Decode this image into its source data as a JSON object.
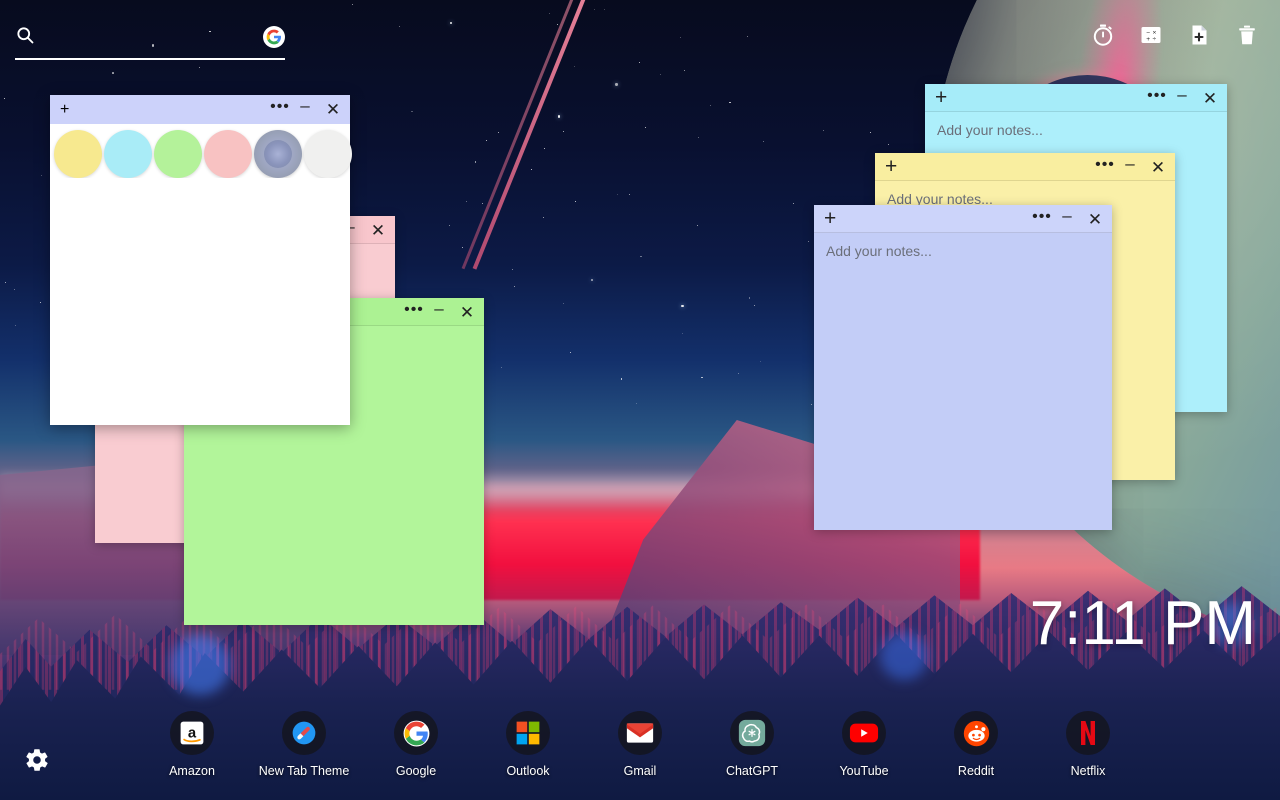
{
  "search": {
    "placeholder": "",
    "value": "",
    "icon": "search-icon",
    "brand_badge": "G"
  },
  "toolbar": {
    "items": [
      {
        "name": "timer-icon",
        "label": "Timer"
      },
      {
        "name": "calculator-icon",
        "label": "Calculator"
      },
      {
        "name": "new-note-icon",
        "label": "New Note"
      },
      {
        "name": "trash-icon",
        "label": "Trash"
      }
    ]
  },
  "color_picker": {
    "title_bar": {
      "add": "+",
      "menu": "•••",
      "minimize": "–",
      "close": "✕"
    },
    "title_bg": "#ccd2fa",
    "swatches": [
      {
        "name": "swatch-yellow",
        "color": "#f7e98f",
        "selected": false
      },
      {
        "name": "swatch-cyan",
        "color": "#a9ecf7",
        "selected": false
      },
      {
        "name": "swatch-green",
        "color": "#b4f29a",
        "selected": false
      },
      {
        "name": "swatch-pink",
        "color": "#f8c2c2",
        "selected": false
      },
      {
        "name": "swatch-purple",
        "color": "#7b86ad",
        "selected": true
      },
      {
        "name": "swatch-white",
        "color": "#f0f0ef",
        "selected": false
      }
    ]
  },
  "notes": [
    {
      "name": "note-cyan",
      "color": "#adeffb",
      "title_color": "#a6ecf9",
      "placeholder": "Add your notes...",
      "text": "",
      "buttons": {
        "add": "+",
        "menu": "•••",
        "minimize": "–",
        "close": "✕"
      }
    },
    {
      "name": "note-yellow",
      "color": "#faf0a8",
      "title_color": "#f9eea0",
      "placeholder": "Add your notes...",
      "text": "",
      "buttons": {
        "add": "+",
        "menu": "•••",
        "minimize": "–",
        "close": "✕"
      }
    },
    {
      "name": "note-periwinkle",
      "color": "#c3cdf7",
      "title_color": "#ccd4fa",
      "placeholder": "Add your notes...",
      "text": "",
      "buttons": {
        "add": "+",
        "menu": "•••",
        "minimize": "–",
        "close": "✕"
      }
    },
    {
      "name": "note-pink",
      "color": "#f9ccd1",
      "title_color": "#f8c6cc",
      "placeholder": "",
      "text": "",
      "buttons": {
        "add": "+",
        "menu": "•••",
        "minimize": "–",
        "close": "✕"
      }
    },
    {
      "name": "note-green",
      "color": "#b2f59a",
      "title_color": "#acf293",
      "placeholder": "",
      "text": "",
      "buttons": {
        "add": "+",
        "menu": "•••",
        "minimize": "–",
        "close": "✕"
      }
    }
  ],
  "clock": {
    "time": "7:11 PM"
  },
  "dock": {
    "items": [
      {
        "name": "dock-amazon",
        "label": "Amazon"
      },
      {
        "name": "dock-new-tab-theme",
        "label": "New Tab Theme"
      },
      {
        "name": "dock-google",
        "label": "Google"
      },
      {
        "name": "dock-outlook",
        "label": "Outlook"
      },
      {
        "name": "dock-gmail",
        "label": "Gmail"
      },
      {
        "name": "dock-chatgpt",
        "label": "ChatGPT"
      },
      {
        "name": "dock-youtube",
        "label": "YouTube"
      },
      {
        "name": "dock-reddit",
        "label": "Reddit"
      },
      {
        "name": "dock-netflix",
        "label": "Netflix"
      }
    ]
  },
  "settings": {
    "name": "settings-gear",
    "label": "Settings"
  }
}
